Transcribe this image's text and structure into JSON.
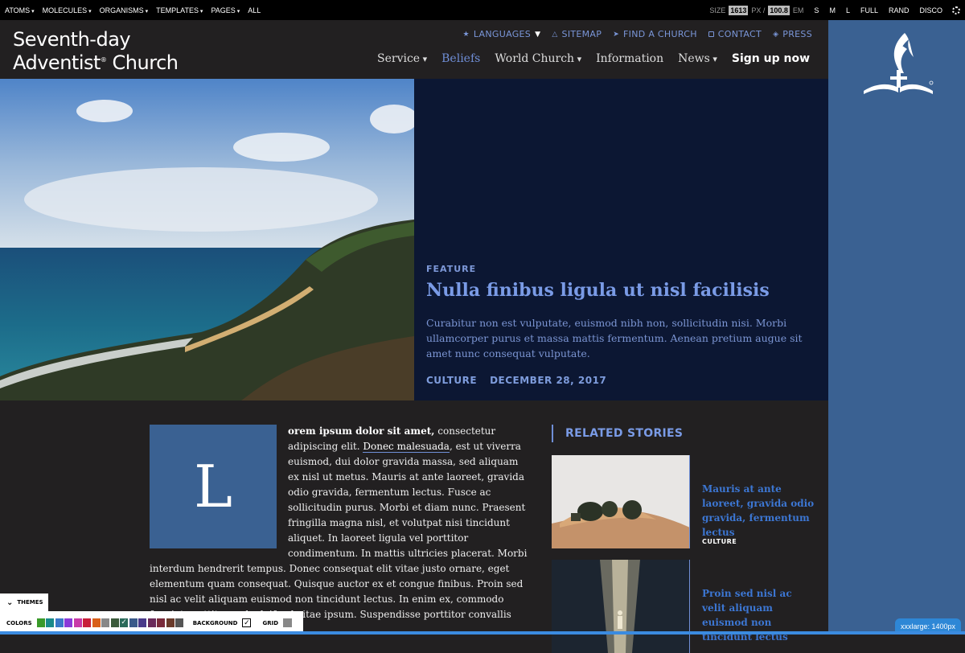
{
  "toolbar": {
    "menus": [
      "ATOMS",
      "MOLECULES",
      "ORGANISMS",
      "TEMPLATES",
      "PAGES",
      "ALL"
    ],
    "size_label": "SIZE",
    "px_value": "1613",
    "px_unit": "PX /",
    "em_value": "100.8",
    "em_unit": "EM",
    "sizes": [
      "S",
      "M",
      "L",
      "FULL",
      "RAND",
      "DISCO"
    ],
    "settings_icon": "gear-icon"
  },
  "header": {
    "logo_line1": "Seventh-day",
    "logo_line2": "Adventist",
    "logo_reg": "®",
    "logo_line3": "Church",
    "utility": [
      {
        "label": "LANGUAGES",
        "icon": "star-icon"
      },
      {
        "label": "SITEMAP",
        "icon": "triangle-icon"
      },
      {
        "label": "FIND A CHURCH",
        "icon": "location-icon"
      },
      {
        "label": "CONTACT",
        "icon": "chat-icon"
      },
      {
        "label": "PRESS",
        "icon": "shield-icon"
      }
    ],
    "nav": [
      "Service",
      "Beliefs",
      "World Church",
      "Information",
      "News",
      "Sign up now"
    ]
  },
  "hero": {
    "kicker": "FEATURE",
    "title": "Nulla finibus ligula ut nisl facilisis",
    "description": "Curabitur non est vulputate, euismod nibh non, sollicitudin nisi. Morbi ullamcorper purus et massa mattis fermentum. Aenean pretium augue sit amet nunc consequat vulputate.",
    "category": "CULTURE",
    "date": "DECEMBER 28, 2017"
  },
  "article": {
    "dropcap": "L",
    "lead": "orem ipsum dolor sit amet,",
    "text1": " consectetur adipiscing elit. ",
    "link": "Donec malesuada",
    "text2": ", est ut viverra euismod, dui dolor gravida massa, sed aliquam ex nisl ut metus. Mauris at ante laoreet, gravida odio gravida, fermentum lectus. Fusce ac sollicitudin purus. Morbi et diam nunc. Praesent fringilla magna nisl, et volutpat nisi tincidunt aliquet. In laoreet ligula vel porttitor condimentum. In mattis ultricies placerat. Morbi interdum hendrerit tempus. Donec consequat elit vitae justo ornare, eget elementum quam consequat. Quisque auctor ex et congue finibus. Proin sed nisl ac velit aliquam euismod non tincidunt lectus. In enim ex, commodo feugiat porttitor sed, eleifend vitae ipsum. Suspendisse porttitor convallis sem."
  },
  "related": {
    "heading": "RELATED STORIES",
    "stories": [
      {
        "title": "Mauris at ante laoreet, gravida odio gravida, fermentum lectus",
        "category": "CULTURE"
      },
      {
        "title": "Proin sed nisl ac velit aliquam euismod non tincidunt lectus",
        "category": ""
      }
    ]
  },
  "pattern_lab": {
    "themes_label": "THEMES",
    "colors_label": "COLORS",
    "background_label": "BACKGROUND",
    "grid_label": "GRID",
    "swatches": [
      "#3a9a2a",
      "#1a8a8a",
      "#3a78c8",
      "#8a3ad8",
      "#c83aa8",
      "#c8203a",
      "#d8601a",
      "#888888",
      "#3a5a3a",
      "#2a6a5a",
      "#3a5a8a",
      "#4a3a8a",
      "#6a2a5a",
      "#7a2a3a",
      "#6a3a2a",
      "#555555"
    ],
    "selected_swatch": 9,
    "breakpoint_badge": "xxxlarge: 1400px"
  },
  "colors": {
    "accent": "#6f8ed6",
    "brand_blue": "#3a6192",
    "hero_panel": "#0c1733"
  }
}
